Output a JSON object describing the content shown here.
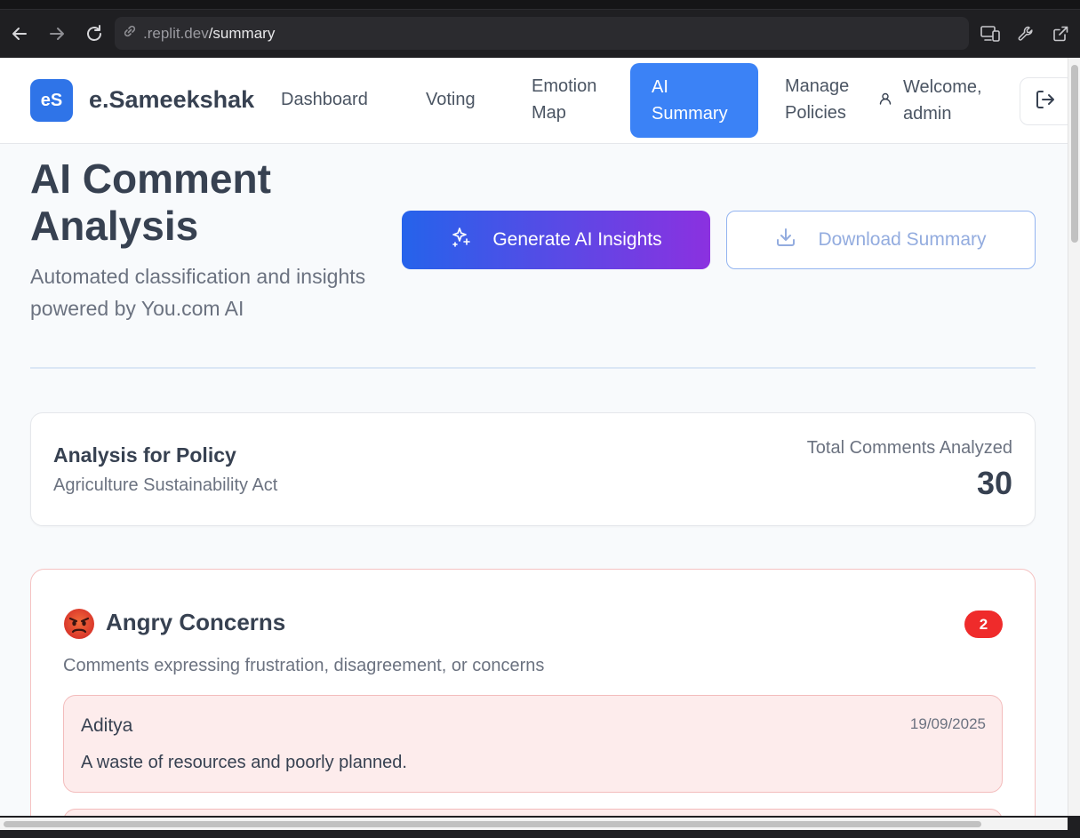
{
  "browser": {
    "url_host": ".replit.dev",
    "url_path": "/summary"
  },
  "app": {
    "logo_text": "eS",
    "brand": "e.Sameekshak",
    "nav": [
      {
        "label": "Dashboard"
      },
      {
        "label": "Voting"
      },
      {
        "label": "Emotion Map"
      },
      {
        "label": "AI Summary",
        "active": true
      },
      {
        "label": "Manage Policies"
      }
    ],
    "welcome": "Welcome, admin"
  },
  "page": {
    "title": "AI Comment Analysis",
    "subtitle": "Automated classification and insights powered by You.com AI",
    "generate_label": "Generate AI Insights",
    "download_label": "Download Summary"
  },
  "policy": {
    "label": "Analysis for Policy",
    "name": "Agriculture Sustainability Act",
    "total_label": "Total Comments Analyzed",
    "total_value": "30"
  },
  "angry": {
    "title": "Angry Concerns",
    "count": "2",
    "description": "Comments expressing frustration, disagreement, or concerns",
    "comments": [
      {
        "author": "Aditya",
        "date": "19/09/2025",
        "text": "A waste of resources and poorly planned."
      }
    ]
  },
  "colors": {
    "primary": "#3b82f6",
    "gradient_start": "#2563eb",
    "gradient_end": "#8b31e0",
    "danger": "#ef2b2b"
  }
}
